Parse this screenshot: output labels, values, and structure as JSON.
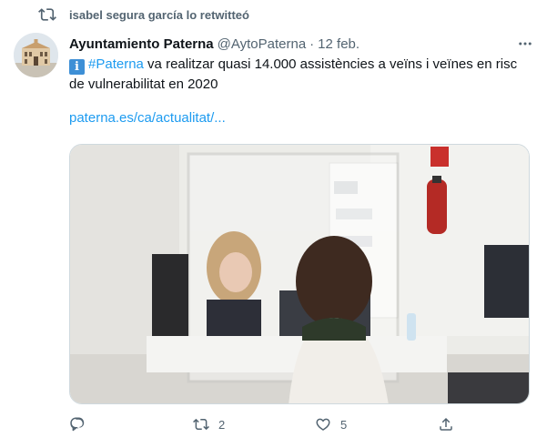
{
  "retweet": {
    "icon": "retweet-icon",
    "text": "isabel segura garcía lo retwitteó"
  },
  "tweet": {
    "author_name": "Ayuntamiento Paterna",
    "handle": "@AytoPaterna",
    "separator": "·",
    "date": "12 feb.",
    "info_emoji": "i",
    "hashtag": "#Paterna",
    "text_rest": " va realitzar quasi 14.000 assistències a veïns i veïnes en risc de vulnerabilitat en 2020",
    "link": "paterna.es/ca/actualitat/..."
  },
  "actions": {
    "reply": {
      "icon": "reply-icon",
      "count": ""
    },
    "retweet": {
      "icon": "retweet-icon",
      "count": "2"
    },
    "like": {
      "icon": "heart-icon",
      "count": "5"
    },
    "share": {
      "icon": "share-icon",
      "count": ""
    }
  },
  "colors": {
    "accent": "#1d9bf0",
    "muted": "#536471",
    "text": "#0f1419"
  }
}
